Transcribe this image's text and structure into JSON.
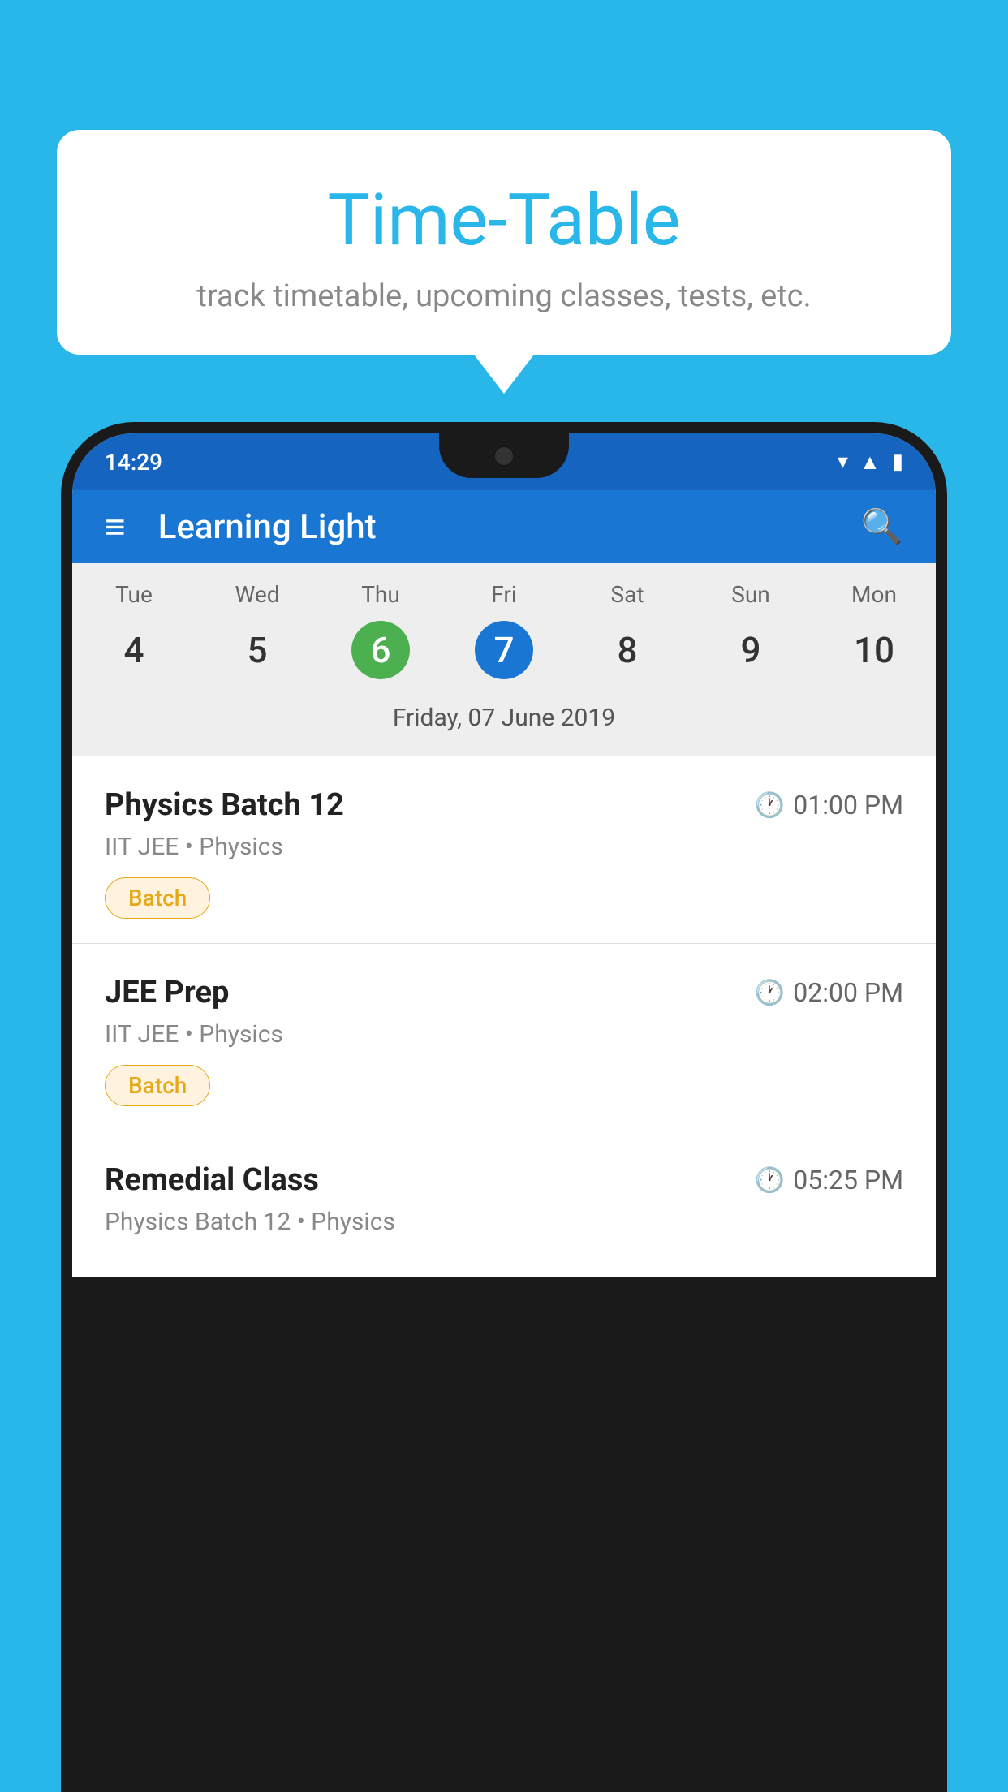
{
  "background_color": "#29B6E8",
  "tooltip": {
    "title": "Time-Table",
    "subtitle": "track timetable, upcoming classes, tests, etc."
  },
  "app": {
    "name": "Learning Light",
    "status_time": "14:29"
  },
  "calendar": {
    "days": [
      {
        "name": "Tue",
        "number": "4"
      },
      {
        "name": "Wed",
        "number": "5"
      },
      {
        "name": "Thu",
        "number": "6",
        "state": "today"
      },
      {
        "name": "Fri",
        "number": "7",
        "state": "selected"
      },
      {
        "name": "Sat",
        "number": "8"
      },
      {
        "name": "Sun",
        "number": "9"
      },
      {
        "name": "Mon",
        "number": "10"
      }
    ],
    "selected_date_label": "Friday, 07 June 2019"
  },
  "schedule": [
    {
      "title": "Physics Batch 12",
      "time": "01:00 PM",
      "subtitle": "IIT JEE • Physics",
      "tag": "Batch"
    },
    {
      "title": "JEE Prep",
      "time": "02:00 PM",
      "subtitle": "IIT JEE • Physics",
      "tag": "Batch"
    },
    {
      "title": "Remedial Class",
      "time": "05:25 PM",
      "subtitle": "Physics Batch 12 • Physics",
      "tag": ""
    }
  ],
  "labels": {
    "hamburger": "≡",
    "search": "🔍",
    "clock": "🕐"
  }
}
